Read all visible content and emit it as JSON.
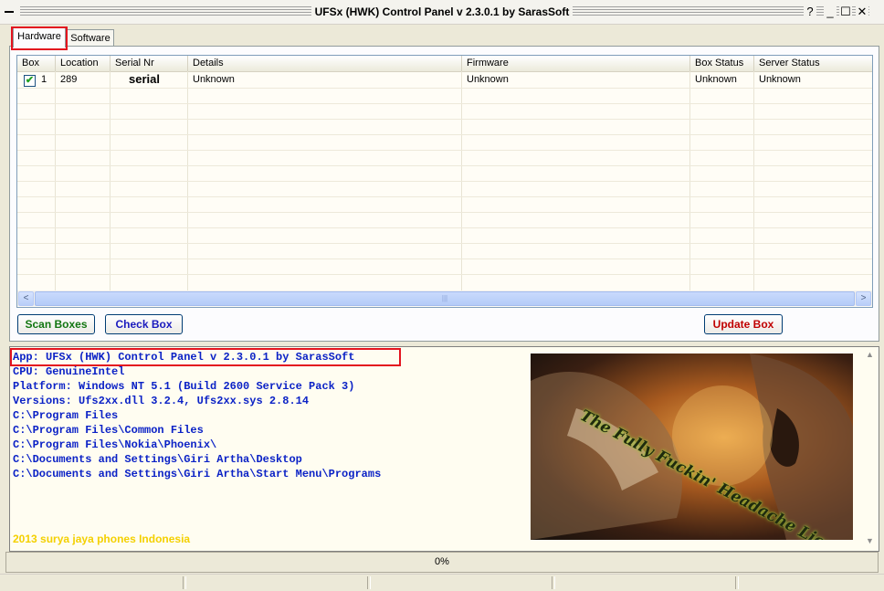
{
  "window": {
    "title": "UFSx (HWK) Control Panel v 2.3.0.1 by SarasSoft",
    "min_glyph": "_",
    "max_glyph": "☐",
    "close_glyph": "✕",
    "help_glyph": "?"
  },
  "tabs": [
    {
      "label": "Hardware",
      "selected": true
    },
    {
      "label": "Software",
      "selected": false
    }
  ],
  "grid": {
    "columns": [
      "Box",
      "Location",
      "Serial Nr",
      "Details",
      "Firmware",
      "Box Status",
      "Server Status"
    ],
    "rows": [
      {
        "checked": true,
        "box": "1",
        "location": "289",
        "serial": "serial",
        "details": "Unknown",
        "firmware": "Unknown",
        "box_status": "Unknown",
        "server_status": "Unknown"
      }
    ],
    "scroll_left": "<",
    "scroll_right": ">",
    "scroll_grip": "|||"
  },
  "buttons": {
    "scan": "Scan Boxes",
    "check": "Check Box",
    "update": "Update Box"
  },
  "log": {
    "lines": [
      "App: UFSx (HWK) Control Panel v 2.3.0.1 by SarasSoft",
      "CPU: GenuineIntel",
      "Platform: Windows NT 5.1 (Build 2600 Service Pack 3)",
      "Versions: Ufs2xx.dll 3.2.4, Ufs2xx.sys 2.8.14",
      "C:\\Program Files",
      "C:\\Program Files\\Common Files",
      "C:\\Program Files\\Nokia\\Phoenix\\",
      "C:\\Documents and Settings\\Giri Artha\\Desktop",
      "C:\\Documents and Settings\\Giri Artha\\Start Menu\\Programs"
    ],
    "credits": "2013 surya jaya phones Indonesia",
    "image_caption": "The Fully Fuckin' Headache Lion"
  },
  "progress": {
    "label": "0%",
    "value": 0
  },
  "colors": {
    "log_text": "#0B22C6",
    "credits": "#F4D000",
    "highlight_box": "#E3141F",
    "scan_button": "#127612",
    "check_button": "#1A1ABE",
    "update_button": "#C00000"
  }
}
